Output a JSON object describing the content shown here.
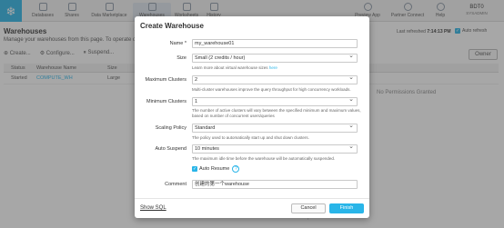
{
  "nav": {
    "items": [
      {
        "label": "Databases",
        "icon": "database-icon"
      },
      {
        "label": "Shares",
        "icon": "share-icon"
      },
      {
        "label": "Data Marketplace",
        "icon": "marketplace-icon"
      },
      {
        "label": "Warehouses",
        "icon": "warehouse-icon"
      },
      {
        "label": "Worksheets",
        "icon": "worksheet-icon"
      },
      {
        "label": "History",
        "icon": "history-icon"
      }
    ],
    "right": [
      {
        "label": "Preview App",
        "icon": "preview-icon"
      },
      {
        "label": "Partner Connect",
        "icon": "partner-icon"
      },
      {
        "label": "Help",
        "icon": "help-icon"
      }
    ],
    "user": {
      "name": "BDT0",
      "role": "SYSADMIN"
    }
  },
  "page": {
    "title": "Warehouses",
    "subtitle": "Manage your warehouses from this page. To operate on",
    "refresh_label": "Last refreshed",
    "refresh_time": "7:14:13 PM",
    "auto_refresh": "Auto refresh",
    "owner_button": "Owner"
  },
  "toolbar": {
    "create": "Create...",
    "configure": "Configure...",
    "suspend": "Suspend..."
  },
  "table": {
    "headers": [
      "Status",
      "Warehouse Name",
      "Size"
    ],
    "rows": [
      {
        "status": "Started",
        "name": "COMPUTE_WH",
        "size": "Large"
      }
    ]
  },
  "no_permission": "No Permissions Granted",
  "modal": {
    "title": "Create Warehouse",
    "name_label": "Name",
    "name_value": "my_warehouse01",
    "size_label": "Size",
    "size_value": "Small  (2 credits / hour)",
    "size_hint_prefix": "Learn more about virtual warehouse sizes",
    "size_hint_link": "here",
    "max_label": "Maximum Clusters",
    "max_value": "2",
    "max_hint": "Multi-cluster warehouses improve the query throughput for high concurrency workloads.",
    "min_label": "Minimum Clusters",
    "min_value": "1",
    "min_hint": "The number of active clusters will vary between the specified minimum and maximum values, based on number of concurrent users/queries",
    "policy_label": "Scaling Policy",
    "policy_value": "Standard",
    "policy_hint": "The policy used to automatically start up and shut down clusters.",
    "suspend_label": "Auto Suspend",
    "suspend_value": "10 minutes",
    "suspend_hint": "The maximum idle time before the warehouse will be automatically suspended.",
    "resume_label": "Auto Resume",
    "comment_label": "Comment",
    "comment_value": "创建的第一个warehouse",
    "show_sql": "Show SQL",
    "cancel": "Cancel",
    "finish": "Finish"
  },
  "colors": {
    "accent": "#29b5e8"
  }
}
